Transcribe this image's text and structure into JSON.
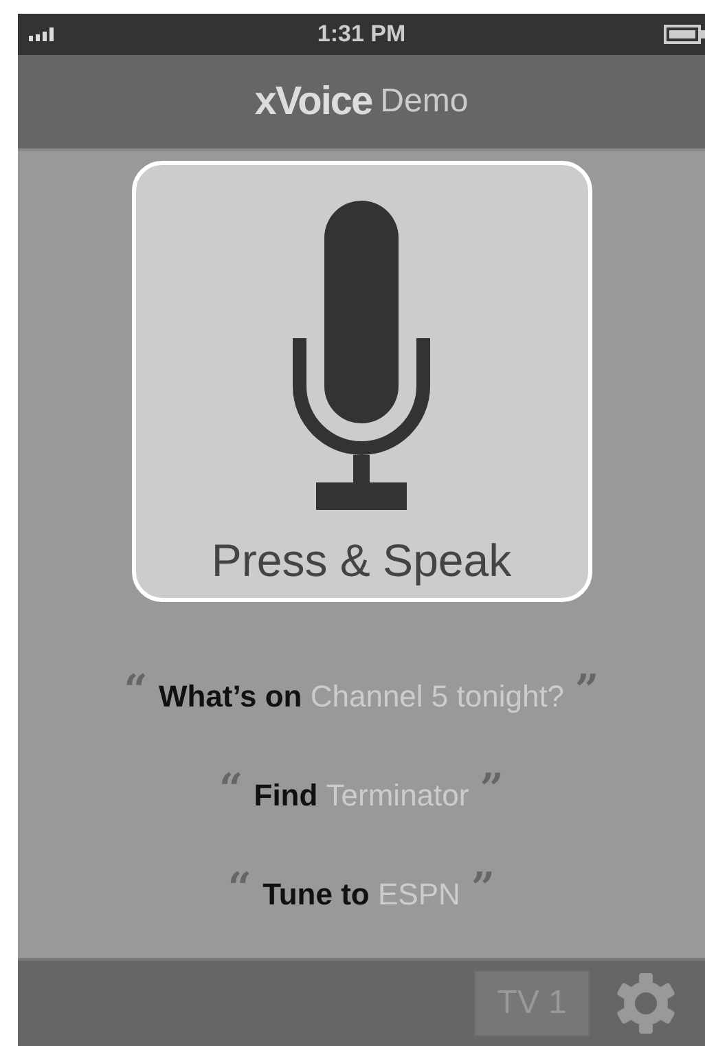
{
  "status_bar": {
    "time": "1:31 PM"
  },
  "nav": {
    "brand": "xVoice",
    "subtitle": "Demo"
  },
  "mic_button": {
    "label": "Press & Speak"
  },
  "phrases": [
    {
      "open_quote": "“",
      "command": "What’s on",
      "subject": "Channel 5 tonight?",
      "close_quote": "”"
    },
    {
      "open_quote": "“",
      "command": "Find",
      "subject": "Terminator",
      "close_quote": "”"
    },
    {
      "open_quote": "“",
      "command": "Tune to",
      "subject": "ESPN",
      "close_quote": "”"
    }
  ],
  "bottom_bar": {
    "device": "TV 1"
  }
}
